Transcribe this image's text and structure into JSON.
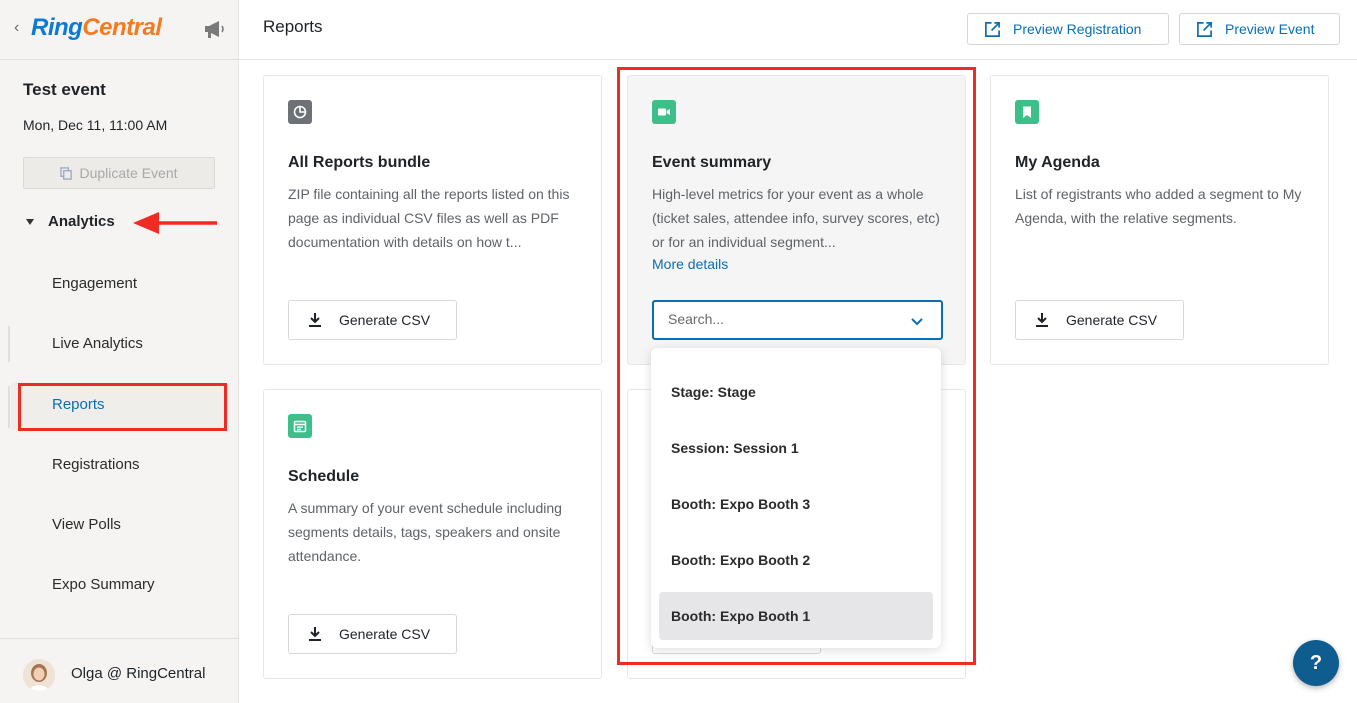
{
  "sidebar": {
    "brand": {
      "ring": "Ring",
      "central": "Central"
    },
    "event": {
      "title": "Test event",
      "date": "Mon, Dec 11, 11:00 AM"
    },
    "duplicate_label": "Duplicate Event",
    "section_label": "Analytics",
    "items": [
      {
        "label": "Engagement"
      },
      {
        "label": "Live Analytics"
      },
      {
        "label": "Reports"
      },
      {
        "label": "Registrations"
      },
      {
        "label": "View Polls"
      },
      {
        "label": "Expo Summary"
      }
    ],
    "user_name": "Olga @ RingCentral"
  },
  "header": {
    "title": "Reports",
    "preview_registration": "Preview Registration",
    "preview_event": "Preview Event"
  },
  "cards": {
    "all_reports": {
      "title": "All Reports bundle",
      "description": "ZIP file containing all the reports listed on this page as individual CSV files as well as PDF documentation with details on how t...",
      "button": "Generate CSV"
    },
    "event_summary": {
      "title": "Event summary",
      "description": "High-level metrics for your event as a whole (ticket sales, attendee info, survey scores, etc) or for an individual segment...",
      "link": "More details",
      "search_placeholder": "Search..."
    },
    "my_agenda": {
      "title": "My Agenda",
      "description": "List of registrants who added a segment to My Agenda, with the relative segments.",
      "button": "Generate CSV"
    },
    "schedule": {
      "title": "Schedule",
      "description": "A summary of your event schedule including segments details, tags, speakers and onsite attendance.",
      "button": "Generate CSV"
    }
  },
  "dropdown": {
    "options": [
      {
        "label": "Stage: Stage"
      },
      {
        "label": "Session: Session 1"
      },
      {
        "label": "Booth: Expo Booth 3"
      },
      {
        "label": "Booth: Expo Booth 2"
      },
      {
        "label": "Booth: Expo Booth 1"
      }
    ]
  },
  "help_label": "?",
  "colors": {
    "accent": "#0a6eb5",
    "brand_blue": "#0a7ad6",
    "brand_orange": "#f47b20",
    "annotation_red": "#ef2b23",
    "icon_gray": "#6e7175",
    "icon_green": "#3dbf8a"
  },
  "icons": {
    "back": "chevron-left-icon",
    "megaphone": "megaphone-icon",
    "duplicate": "copy-icon",
    "external_link": "external-link-icon",
    "pie": "pie-chart-icon",
    "video": "video-camera-icon",
    "bookmark": "bookmark-icon",
    "calendar": "calendar-icon",
    "download": "download-icon",
    "dropdown": "chevron-down-icon"
  }
}
